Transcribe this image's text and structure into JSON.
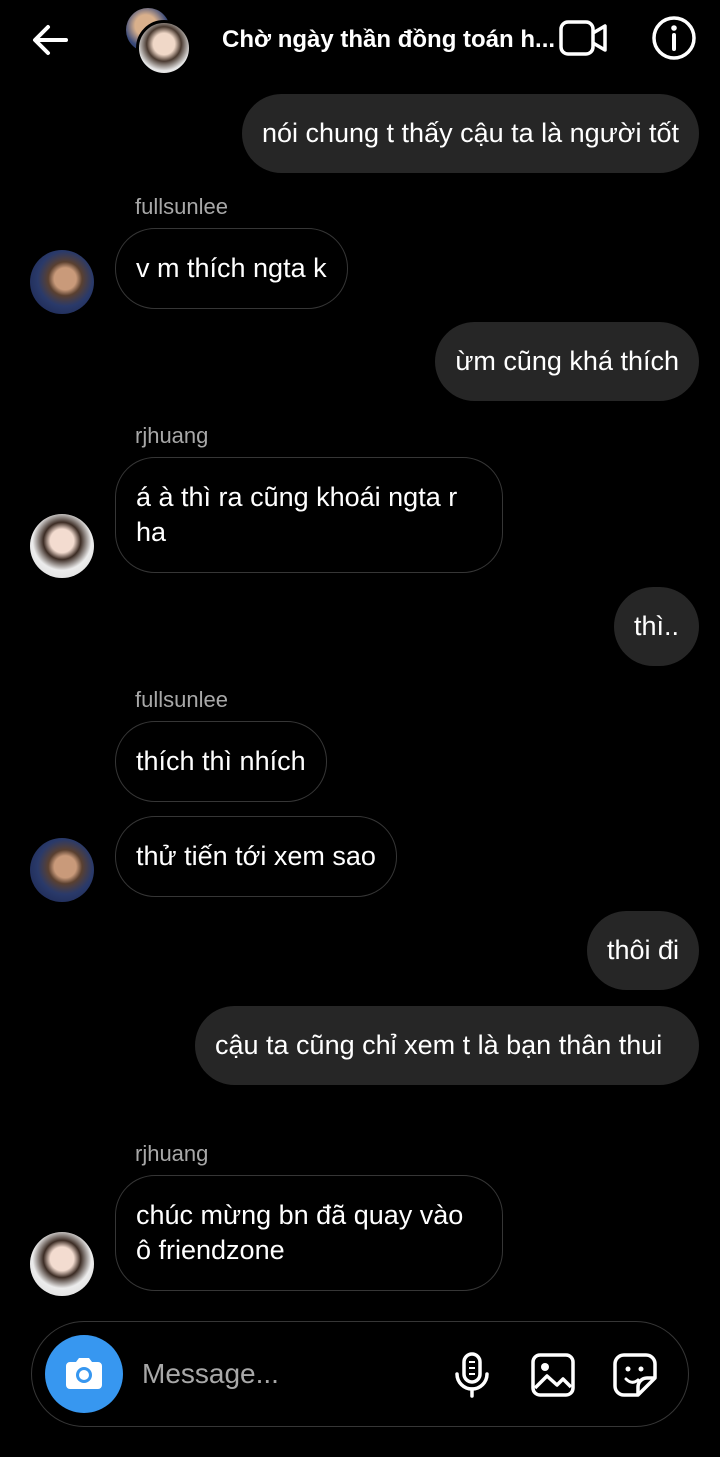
{
  "header": {
    "title": "Chờ ngày thần đồng toán h..."
  },
  "messages": [
    {
      "direction": "out",
      "text": "nói chung t thấy cậu ta là người tốt"
    },
    {
      "direction": "in",
      "sender": "fullsunlee",
      "text": "v m thích ngta k"
    },
    {
      "direction": "out",
      "text": "ừm cũng khá thích"
    },
    {
      "direction": "in",
      "sender": "rjhuang",
      "text": "á à thì ra cũng khoái ngta r ha"
    },
    {
      "direction": "out",
      "text": "thì.."
    },
    {
      "direction": "in",
      "sender": "fullsunlee",
      "text": "thích thì nhích"
    },
    {
      "direction": "in",
      "sender": "fullsunlee",
      "text": "thử tiến tới xem sao"
    },
    {
      "direction": "out",
      "text": "thôi đi"
    },
    {
      "direction": "out",
      "text": "cậu ta cũng chỉ xem t là bạn thân thui"
    },
    {
      "direction": "in",
      "sender": "rjhuang",
      "text": "chúc mừng bn đã quay vào ô friendzone"
    }
  ],
  "composer": {
    "placeholder": "Message..."
  },
  "colors": {
    "background": "#000000",
    "outgoing_bubble": "#262626",
    "incoming_border": "#363636",
    "sender_name": "#a8a8a8",
    "camera_button": "#3797f0"
  }
}
